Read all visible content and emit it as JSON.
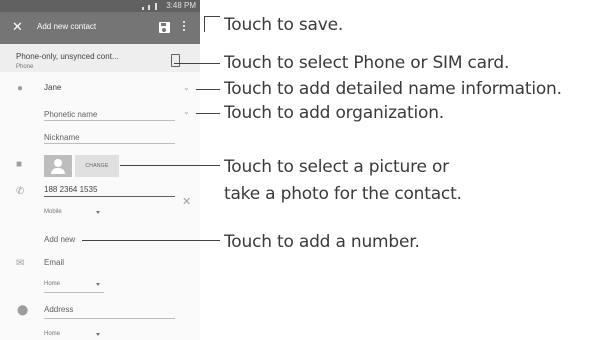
{
  "status_bar": {
    "time": "3:48 PM"
  },
  "toolbar": {
    "title": "Add new contact"
  },
  "account": {
    "name": "Phone-only, unsynced cont...",
    "type": "Phone"
  },
  "name_field": {
    "value": "Jane"
  },
  "phonetic_name": {
    "placeholder": "Phonetic name"
  },
  "nickname": {
    "placeholder": "Nickname"
  },
  "photo": {
    "change_label": "CHANGE"
  },
  "phone_field": {
    "value": "188 2364 1535",
    "type": "Mobile"
  },
  "add_new": {
    "label": "Add new"
  },
  "email_field": {
    "placeholder": "Email",
    "type": "Home"
  },
  "address_field": {
    "placeholder": "Address",
    "type": "Home"
  },
  "callouts": {
    "save": "Touch to save.",
    "select_account": "Touch to select Phone or SIM card.",
    "name_detail": "Touch to add detailed name information.",
    "organization": "Touch to add organization.",
    "picture_line1": "Touch to select a picture or",
    "picture_line2": "take a photo for the contact.",
    "add_number": "Touch to add a number."
  }
}
